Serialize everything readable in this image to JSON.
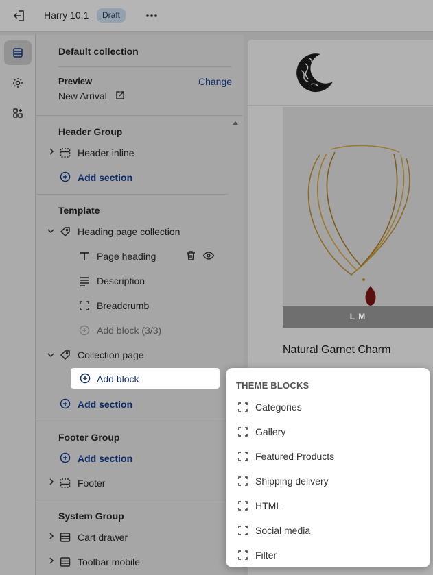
{
  "topbar": {
    "title": "Harry 10.1",
    "badge": "Draft"
  },
  "panel": {
    "collection_title": "Default collection",
    "preview_label": "Preview",
    "change_label": "Change",
    "preview_value": "New Arrival",
    "header_group": {
      "title": "Header Group",
      "items": [
        "Header inline"
      ],
      "add_section": "Add section"
    },
    "template": {
      "title": "Template",
      "heading_section": "Heading page collection",
      "blocks": [
        "Page heading",
        "Description",
        "Breadcrumb"
      ],
      "add_block_disabled": "Add block (3/3)",
      "collection_section": "Collection page",
      "add_block": "Add block",
      "add_section": "Add section"
    },
    "footer_group": {
      "title": "Footer Group",
      "add_section": "Add section",
      "items": [
        "Footer"
      ]
    },
    "system_group": {
      "title": "System Group",
      "items": [
        "Cart drawer",
        "Toolbar mobile"
      ]
    }
  },
  "preview": {
    "sizes": "L    M",
    "product_name": "Natural Garnet Charm"
  },
  "popup": {
    "heading": "THEME BLOCKS",
    "items": [
      "Categories",
      "Gallery",
      "Featured Products",
      "Shipping delivery",
      "HTML",
      "Social media",
      "Filter"
    ]
  },
  "colors": {
    "link": "#0b2a66",
    "badge_bg": "#94a2b0",
    "overlay": "#a6a6a6"
  },
  "icons": {
    "exit": "exit-icon",
    "more": "more-icon",
    "sections": "sections-icon",
    "settings": "gear-icon",
    "apps": "apps-icon",
    "external": "external-link-icon",
    "chevron": "chevron-icon",
    "section_header": "header-section-icon",
    "collection_tag": "tag-icon",
    "text": "text-icon",
    "description": "paragraph-icon",
    "breadcrumb": "breadcrumb-icon",
    "add": "plus-circle-icon",
    "delete": "trash-icon",
    "visibility": "eye-icon",
    "block": "block-icon"
  }
}
